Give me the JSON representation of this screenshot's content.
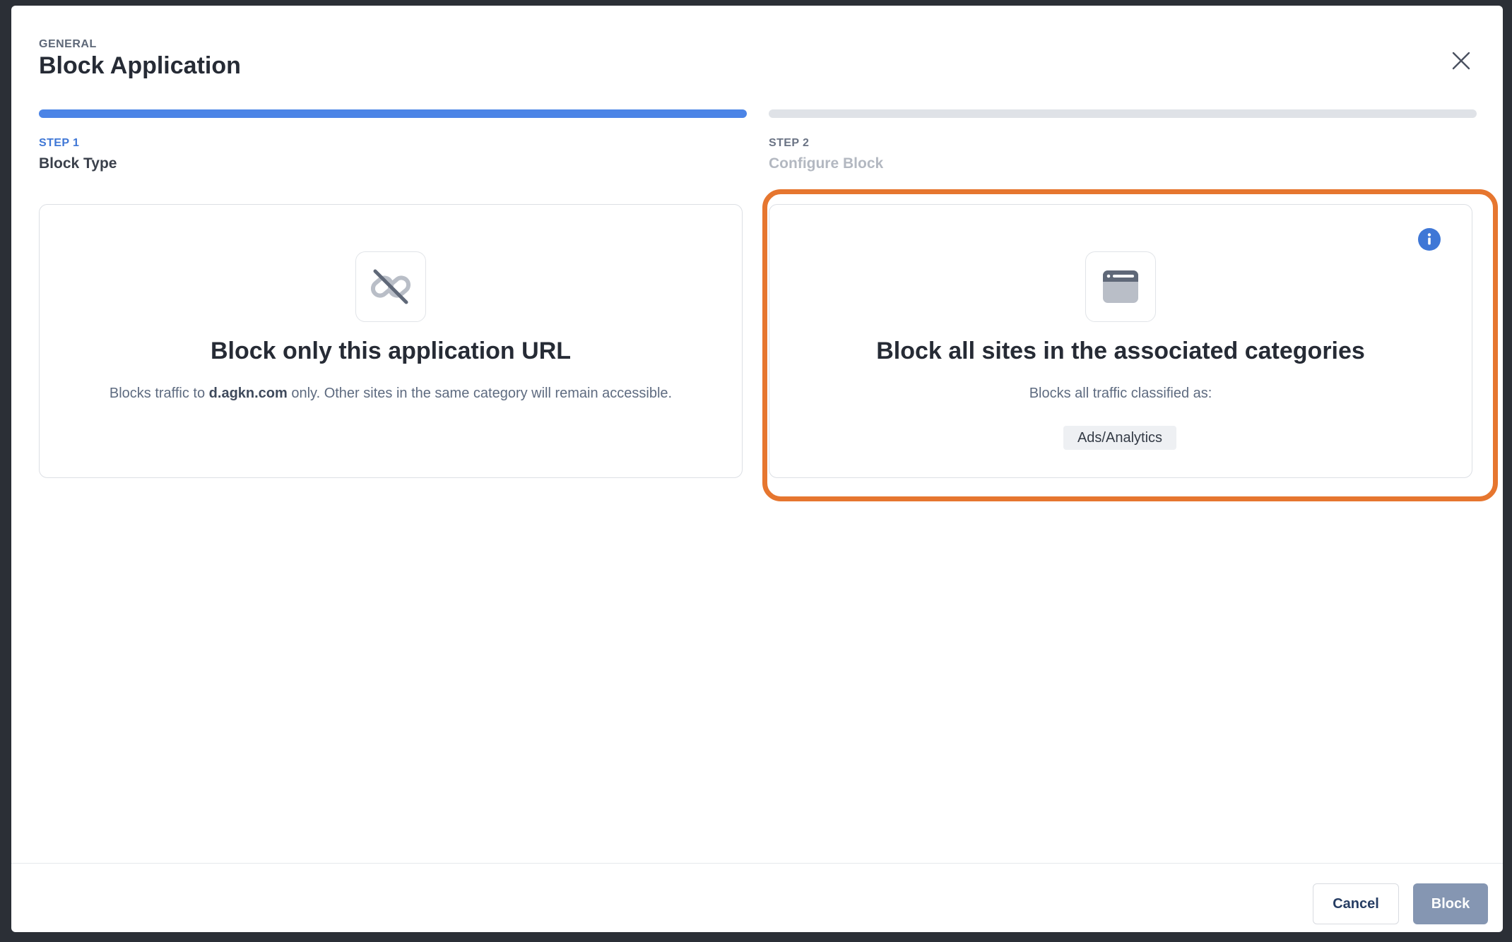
{
  "header": {
    "eyebrow": "GENERAL",
    "title": "Block Application"
  },
  "steps": [
    {
      "number": "STEP 1",
      "label": "Block Type",
      "status": "active"
    },
    {
      "number": "STEP 2",
      "label": "Configure Block",
      "status": "inactive"
    }
  ],
  "options": [
    {
      "icon": "unlink-icon",
      "title": "Block only this application URL",
      "desc_prefix": "Blocks traffic to ",
      "desc_bold": "d.agkn.com",
      "desc_suffix": " only. Other sites in the same category will remain accessible."
    },
    {
      "icon": "browser-window-icon",
      "title": "Block all sites in the associated categories",
      "desc": "Blocks all traffic classified as:",
      "tag": "Ads/Analytics",
      "info_icon": "info-icon",
      "highlighted": true
    }
  ],
  "footer": {
    "cancel_label": "Cancel",
    "block_label": "Block"
  },
  "colors": {
    "accent": "#4b84e6",
    "highlight": "#e6762f",
    "primary_disabled": "#8596b2"
  }
}
